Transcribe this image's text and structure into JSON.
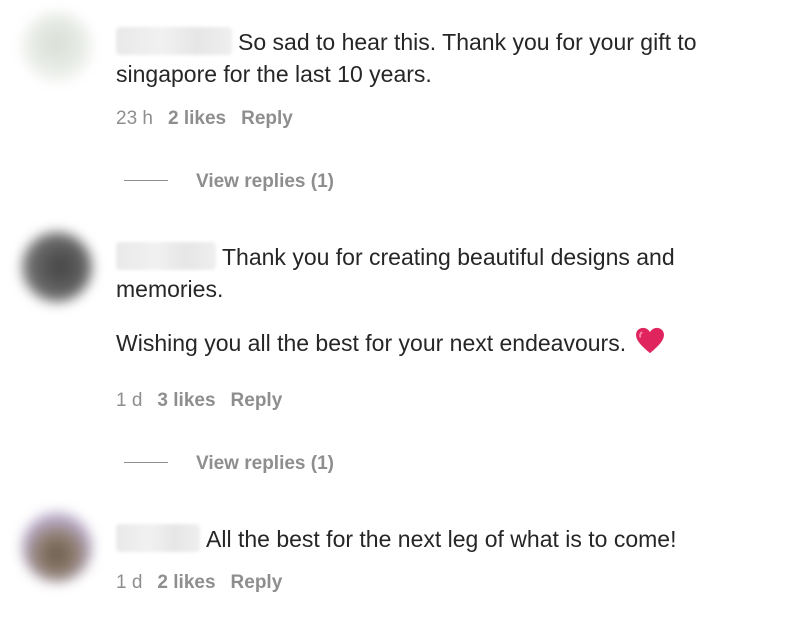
{
  "comments": [
    {
      "lines": [
        "So sad to hear this. Thank you for your gift to",
        "singapore for the last 10 years."
      ],
      "time": "23 h",
      "likes": "2 likes",
      "reply": "Reply",
      "view_replies": "View replies (1)"
    },
    {
      "lines": [
        "Thank you for creating beautiful designs and",
        "memories."
      ],
      "line3": "Wishing you all the best for your next endeavours.",
      "emoji": "red-heart-icon",
      "time": "1 d",
      "likes": "3 likes",
      "reply": "Reply",
      "view_replies": "View replies (1)"
    },
    {
      "lines": [
        "All the best for the next leg of what is to come!"
      ],
      "time": "1 d",
      "likes": "2 likes",
      "reply": "Reply"
    }
  ],
  "colors": {
    "text": "#262626",
    "muted": "#8e8e8e",
    "heart": "#e0245e"
  }
}
